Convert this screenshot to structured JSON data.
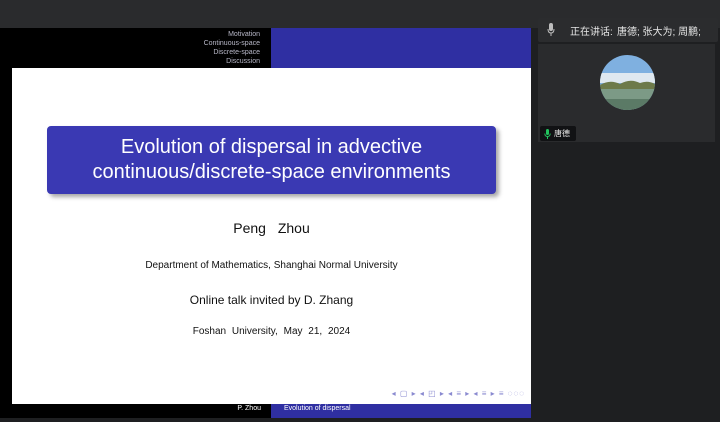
{
  "nav": {
    "items": [
      "Motivation",
      "Continuous-space",
      "Discrete-space",
      "Discussion"
    ]
  },
  "slide": {
    "title_line1": "Evolution of dispersal in advective",
    "title_line2": "continuous/discrete-space environments",
    "author": "Peng Zhou",
    "department": "Department of Mathematics, Shanghai Normal University",
    "talk": "Online talk invited by D. Zhang",
    "venue": "Foshan University, May 21, 2024",
    "beamer_nav": "◂ ▢ ▸ ◂ ◰ ▸ ◂ ≡ ▸ ◂ ≡ ▸ ≡ ◌◌◌"
  },
  "footer": {
    "author": "P. Zhou",
    "short_title": "Evolution of dispersal"
  },
  "meeting": {
    "speaking_label": "正在讲话:",
    "speaking_names": "唐德; 张大为; 周鹏;",
    "participant_name": "唐德",
    "mic_color": "#22c55e"
  }
}
